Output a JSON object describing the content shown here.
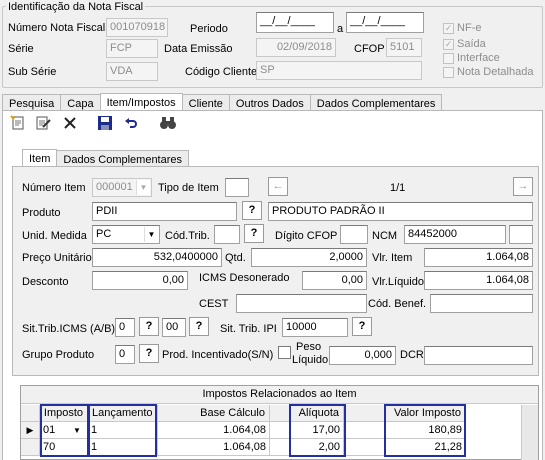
{
  "header": {
    "group_title": "Identificação da Nota Fiscal",
    "numero_label": "Número Nota Fiscal",
    "numero_value": "001070918",
    "serie_label": "Série",
    "serie_value": "FCP",
    "subserie_label": "Sub Série",
    "subserie_value": "VDA",
    "periodo_label": "Periodo",
    "periodo_from": "__/__/____",
    "periodo_sep": "a",
    "periodo_to": "__/__/____",
    "emissao_label": "Data Emissão",
    "emissao_value": "02/09/2018",
    "cfop_label": "CFOP",
    "cfop_value": "5101",
    "cliente_label": "Código Cliente",
    "cliente_value": "SP",
    "checks": [
      {
        "label": "NF-e",
        "checked": true
      },
      {
        "label": "Saída",
        "checked": true
      },
      {
        "label": "Interface",
        "checked": false
      },
      {
        "label": "Nota Detalhada",
        "checked": false
      }
    ]
  },
  "main_tabs": [
    "Pesquisa",
    "Capa",
    "Item/Impostos",
    "Cliente",
    "Outros Dados",
    "Dados Complementares"
  ],
  "item_tabs": [
    "Item",
    "Dados Complementares"
  ],
  "item": {
    "numero_label": "Número Item",
    "numero_value": "000001",
    "tipo_label": "Tipo de Item",
    "tipo_value": "",
    "pager": "1/1",
    "produto_label": "Produto",
    "produto_code": "PDII",
    "produto_desc": "PRODUTO PADRÃO II",
    "unid_label": "Unid. Medida",
    "unid_value": "PC",
    "codtrib_label": "Cód.Trib.",
    "codtrib_value": "",
    "digito_label": "Dígito CFOP",
    "digito_value": "",
    "ncm_label": "NCM",
    "ncm_value": "84452000",
    "ncm_extra": "",
    "preco_label": "Preço Unitário",
    "preco_value": "532,0400000",
    "qtd_label": "Qtd.",
    "qtd_value": "2,0000",
    "vlritem_label": "Vlr. Item",
    "vlritem_value": "1.064,08",
    "desconto_label": "Desconto",
    "desconto_value": "0,00",
    "icmsdes_label": "ICMS Desonerado",
    "icmsdes_value": "0,00",
    "vlrliq_label": "Vlr.Líquido",
    "vlrliq_value": "1.064,08",
    "cest_label": "CEST",
    "cest_value": "",
    "benef_label": "Cód. Benef.",
    "benef_value": "",
    "sittrib_label": "Sit.Trib.ICMS (A/B)",
    "sittrib_a": "0",
    "sittrib_b": "00",
    "sitipi_label": "Sit. Trib. IPI",
    "sitipi_value": "10000",
    "grupo_label": "Grupo Produto",
    "grupo_value": "0",
    "incent_label": "Prod. Incentivado(S/N)",
    "peso_label1": "Peso",
    "peso_label2": "Líquido",
    "peso_value": "0,000",
    "dcr_label": "DCR",
    "dcr_value": "",
    "help": "?"
  },
  "impostos": {
    "title": "Impostos Relacionados ao Item",
    "columns": [
      "Imposto",
      "Lançamento",
      "Base Cálculo",
      "Alíquota",
      "Valor Imposto"
    ],
    "rows": [
      {
        "imposto": "01",
        "lanc": "1",
        "base": "1.064,08",
        "aliq": "17,00",
        "valor": "180,89"
      },
      {
        "imposto": "70",
        "lanc": "1",
        "base": "1.064,08",
        "aliq": "2,00",
        "valor": "21,28"
      }
    ]
  },
  "colors": {
    "highlight": "#2430a0",
    "disabled_text": "#8d8d8d"
  }
}
